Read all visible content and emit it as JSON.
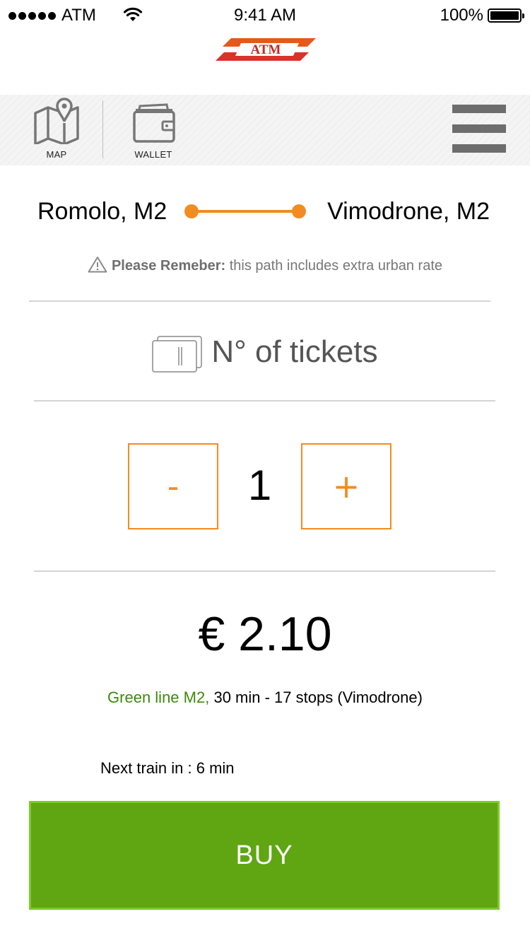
{
  "status_bar": {
    "carrier": "ATM",
    "time": "9:41 AM",
    "battery": "100%"
  },
  "header": {
    "logo_text": "ATM"
  },
  "toolbar": {
    "map_label": "MAP",
    "wallet_label": "WALLET"
  },
  "route": {
    "from": "Romolo, M2",
    "to": "Vimodrone, M2"
  },
  "reminder": {
    "bold": "Please Remeber:",
    "text": "this path includes extra urban rate"
  },
  "tickets": {
    "title": "N° of tickets",
    "minus_label": "-",
    "plus_label": "+",
    "quantity": "1"
  },
  "price": "€ 2.10",
  "line_info": {
    "line": "Green line M2,",
    "details": "30 min - 17 stops (Vimodrone)"
  },
  "next_train": "Next train in : 6 min",
  "buy_label": "BUY",
  "colors": {
    "accent_orange": "#f28c20",
    "buy_green": "#5fa612",
    "line_green": "#3d8a0c"
  },
  "icons": [
    "map-icon",
    "wallet-icon",
    "hamburger-menu-icon",
    "warning-icon",
    "tickets-icon",
    "wifi-icon",
    "battery-icon"
  ]
}
